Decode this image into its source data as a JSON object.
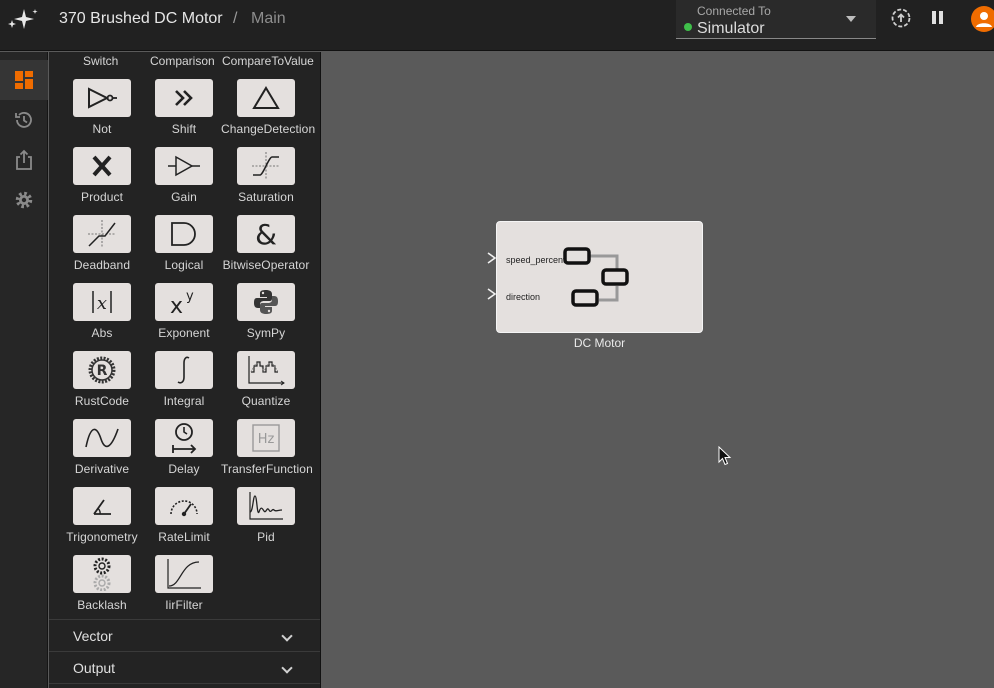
{
  "header": {
    "project_name": "370 Brushed DC Motor",
    "separator": "/",
    "page_name": "Main",
    "connection_label": "Connected To",
    "connection_value": "Simulator",
    "status_color": "#3fbf4a",
    "accent": "#ef6c00"
  },
  "rail": {
    "items": [
      "dashboard-icon",
      "history-icon",
      "share-icon",
      "settings-icon"
    ]
  },
  "palette": {
    "top_row": [
      "Switch",
      "Comparison",
      "CompareToValue"
    ],
    "blocks": [
      {
        "label": "Not",
        "icon": "not-gate-icon"
      },
      {
        "label": "Shift",
        "icon": "shift-icon"
      },
      {
        "label": "ChangeDetection",
        "icon": "triangle-icon"
      },
      {
        "label": "Product",
        "icon": "multiply-icon"
      },
      {
        "label": "Gain",
        "icon": "gain-icon"
      },
      {
        "label": "Saturation",
        "icon": "saturation-icon"
      },
      {
        "label": "Deadband",
        "icon": "deadband-icon"
      },
      {
        "label": "Logical",
        "icon": "and-gate-icon"
      },
      {
        "label": "BitwiseOperator",
        "icon": "ampersand-icon"
      },
      {
        "label": "Abs",
        "icon": "abs-icon"
      },
      {
        "label": "Exponent",
        "icon": "exponent-icon"
      },
      {
        "label": "SymPy",
        "icon": "python-icon"
      },
      {
        "label": "RustCode",
        "icon": "rust-icon"
      },
      {
        "label": "Integral",
        "icon": "integral-icon"
      },
      {
        "label": "Quantize",
        "icon": "quantize-icon"
      },
      {
        "label": "Derivative",
        "icon": "derivative-icon"
      },
      {
        "label": "Delay",
        "icon": "delay-icon"
      },
      {
        "label": "TransferFunction",
        "icon": "hz-icon"
      },
      {
        "label": "Trigonometry",
        "icon": "angle-icon"
      },
      {
        "label": "RateLimit",
        "icon": "gauge-icon"
      },
      {
        "label": "Pid",
        "icon": "pid-response-icon"
      },
      {
        "label": "Backlash",
        "icon": "gears-icon"
      },
      {
        "label": "IirFilter",
        "icon": "filter-curve-icon"
      }
    ],
    "sections": [
      {
        "label": "Vector"
      },
      {
        "label": "Output"
      }
    ]
  },
  "canvas": {
    "node": {
      "title": "DC Motor",
      "inputs": [
        "speed_percent",
        "direction"
      ]
    }
  }
}
